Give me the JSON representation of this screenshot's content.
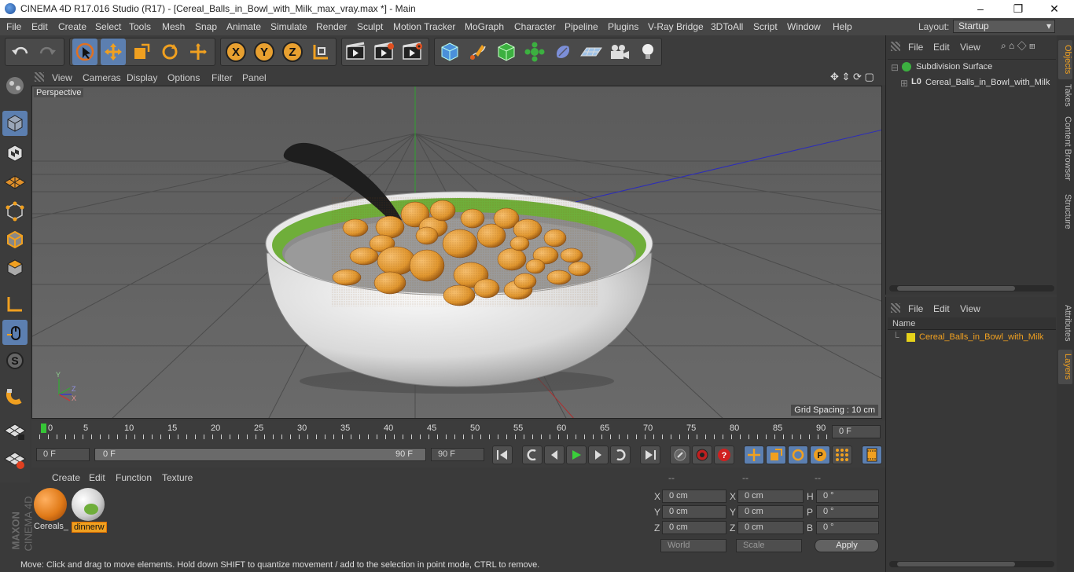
{
  "window": {
    "title": "CINEMA 4D R17.016 Studio (R17) - [Cereal_Balls_in_Bowl_with_Milk_max_vray.max *] - Main",
    "minimize": "–",
    "maximize": "❐",
    "close": "✕"
  },
  "menu": [
    "File",
    "Edit",
    "Create",
    "Select",
    "Tools",
    "Mesh",
    "Snap",
    "Animate",
    "Simulate",
    "Render",
    "Sculpt",
    "Motion Tracker",
    "MoGraph",
    "Character",
    "Pipeline",
    "Plugins",
    "V-Ray Bridge",
    "3DToAll",
    "Script",
    "Window",
    "Help"
  ],
  "layout": {
    "label": "Layout:",
    "value": "Startup"
  },
  "toolbar": {
    "x_label": "X",
    "y_label": "Y",
    "z_label": "Z"
  },
  "viewport": {
    "menu": [
      "View",
      "Cameras",
      "Display",
      "Options",
      "Filter",
      "Panel"
    ],
    "camera": "Perspective",
    "grid_spacing": "Grid Spacing : 10 cm",
    "axis_y": "Y",
    "axis_z": "Z",
    "axis_x": "X"
  },
  "timeline": {
    "ticks": [
      "0",
      "5",
      "10",
      "15",
      "20",
      "25",
      "30",
      "35",
      "40",
      "45",
      "50",
      "55",
      "60",
      "65",
      "70",
      "75",
      "80",
      "85",
      "90"
    ],
    "current_frame": "0 F"
  },
  "transport": {
    "start_field": "0 F",
    "range_start": "0 F",
    "range_end": "90 F",
    "end_field": "90 F"
  },
  "material_manager": {
    "menu": [
      "Create",
      "Edit",
      "Function",
      "Texture"
    ],
    "materials": [
      {
        "name": "Cereals_",
        "color": "#e58a22"
      },
      {
        "name": "dinnerw",
        "color": "#d8d8d8"
      }
    ]
  },
  "coordinates": {
    "headers": [
      "--",
      "--",
      "--"
    ],
    "rows": [
      {
        "a": "X",
        "av": "0 cm",
        "b": "X",
        "bv": "0 cm",
        "c": "H",
        "cv": "0 °"
      },
      {
        "a": "Y",
        "av": "0 cm",
        "b": "Y",
        "bv": "0 cm",
        "c": "P",
        "cv": "0 °"
      },
      {
        "a": "Z",
        "av": "0 cm",
        "b": "Z",
        "bv": "0 cm",
        "c": "B",
        "cv": "0 °"
      }
    ],
    "space": "World",
    "mode": "Scale",
    "apply": "Apply"
  },
  "objects": {
    "menu": [
      "File",
      "Edit",
      "View"
    ],
    "items": [
      {
        "label": "Subdivision Surface"
      },
      {
        "label": "Cereal_Balls_in_Bowl_with_Milk"
      }
    ]
  },
  "layers": {
    "menu": [
      "File",
      "Edit",
      "View"
    ],
    "column": "Name",
    "items": [
      {
        "label": "Cereal_Balls_in_Bowl_with_Milk",
        "color": "#e6d21a"
      }
    ]
  },
  "side_tabs": [
    "Objects",
    "Takes",
    "Content Browser",
    "Structure",
    "Attributes",
    "Layers"
  ],
  "logo": {
    "maxon": "MAXON",
    "cinema": "CINEMA 4D"
  },
  "status": "Move: Click and drag to move elements. Hold down SHIFT to quantize movement / add to the selection in point mode, CTRL to remove."
}
